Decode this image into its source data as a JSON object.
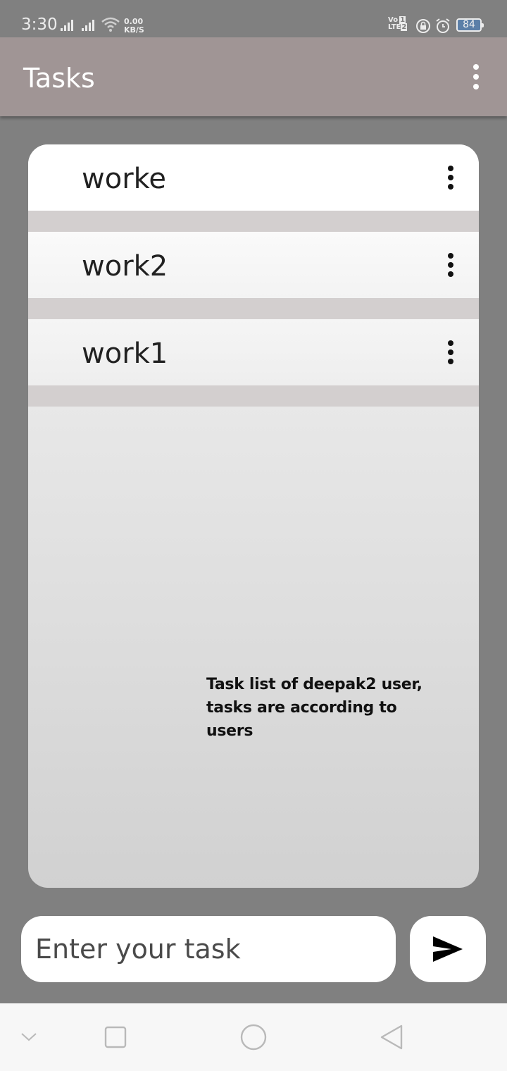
{
  "status_bar": {
    "time": "3:30",
    "net_speed_value": "0.00",
    "net_speed_unit": "KB/S",
    "volte_top": "Vo",
    "volte_bottom": "LTE",
    "sim_top": "1",
    "sim_bottom": "2",
    "battery": "84"
  },
  "app_bar": {
    "title": "Tasks",
    "menu_icon": "more-vert-icon"
  },
  "tasks": [
    {
      "name": "worke"
    },
    {
      "name": "work2"
    },
    {
      "name": "work1"
    }
  ],
  "annotation": {
    "line1": "Task list of deepak2 user,",
    "line2": "tasks are according to users"
  },
  "input": {
    "placeholder": "Enter your task",
    "value": ""
  },
  "send_icon": "send-icon",
  "nav_bar": {
    "icons": [
      "chevron-down-icon",
      "recents-icon",
      "home-icon",
      "back-icon"
    ]
  },
  "colors": {
    "app_bar": "#a09595",
    "background": "#808080",
    "divider": "#d3cfcf",
    "battery_fill": "#5b7fa8"
  }
}
